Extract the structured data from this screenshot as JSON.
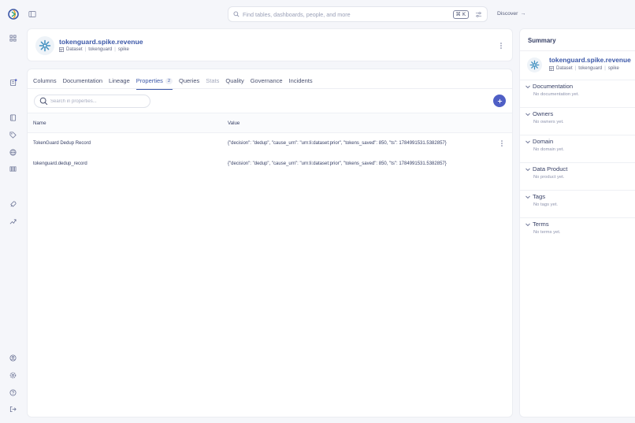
{
  "topbar": {
    "search_placeholder": "Find tables, dashboards, people, and more",
    "shortcut": "⌘ K",
    "discover_label": "Discover",
    "discover_arrow": "→"
  },
  "dataset": {
    "title": "tokenguard.spike.revenue",
    "type": "Dataset",
    "platform": "tokenguard",
    "container": "spike",
    "separator": "|"
  },
  "tabs": [
    {
      "label": "Columns",
      "state": "normal"
    },
    {
      "label": "Documentation",
      "state": "normal"
    },
    {
      "label": "Lineage",
      "state": "normal"
    },
    {
      "label": "Properties",
      "state": "active",
      "badge": "2"
    },
    {
      "label": "Queries",
      "state": "normal"
    },
    {
      "label": "Stats",
      "state": "disabled"
    },
    {
      "label": "Quality",
      "state": "normal"
    },
    {
      "label": "Governance",
      "state": "normal"
    },
    {
      "label": "Incidents",
      "state": "normal"
    }
  ],
  "properties": {
    "search_placeholder": "Search in properties...",
    "columns": {
      "name": "Name",
      "value": "Value"
    },
    "rows": [
      {
        "name": "TokenGuard Dedup Record",
        "value": "{\"decision\": \"dedup\", \"cause_urn\": \"urn:li:dataset:prior\", \"tokens_saved\": 850, \"ts\": 1784991531.5382857}"
      },
      {
        "name": "tokenguard.dedup_record",
        "value": "{\"decision\": \"dedup\", \"cause_urn\": \"urn:li:dataset:prior\", \"tokens_saved\": 850, \"ts\": 1784991531.5382857}"
      }
    ]
  },
  "summary": {
    "title": "Summary",
    "sections": [
      {
        "title": "Documentation",
        "empty": "No documentation yet."
      },
      {
        "title": "Owners",
        "empty": "No owners yet."
      },
      {
        "title": "Domain",
        "empty": "No domain yet."
      },
      {
        "title": "Data Product",
        "empty": "No product yet."
      },
      {
        "title": "Tags",
        "empty": "No tags yet."
      },
      {
        "title": "Terms",
        "empty": "No terms yet."
      }
    ]
  },
  "colors": {
    "accent": "#3c58a8",
    "add_button": "#4f5fc5",
    "notification_dot": "#4f5fc5"
  },
  "icons": {
    "rail_top": [
      "home-grid-icon",
      "document-icon"
    ],
    "rail_mid": [
      "book-icon",
      "tag-icon",
      "globe-icon",
      "library-icon",
      "rocket-icon",
      "trending-icon"
    ],
    "rail_bottom": [
      "user-icon",
      "settings-icon",
      "help-icon",
      "logout-icon"
    ]
  }
}
